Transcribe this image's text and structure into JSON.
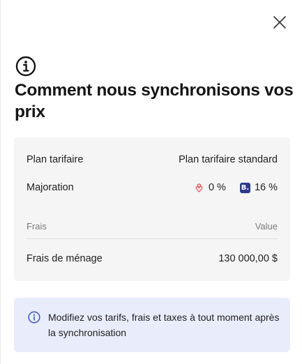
{
  "dialog": {
    "title": "Comment nous synchronisons vos prix",
    "close_icon": "close-icon",
    "header_icon": "info-circle-icon"
  },
  "summary": {
    "plan_label": "Plan tarifaire",
    "plan_value": "Plan tarifaire standard",
    "markup_label": "Majoration",
    "markup_airbnb": "0 %",
    "markup_booking": "16 %",
    "airbnb_icon": "airbnb-icon",
    "booking_icon": "booking-icon",
    "booking_badge": "B."
  },
  "fees": {
    "column_left": "Frais",
    "column_right": "Value",
    "rows": [
      {
        "label": "Frais de ménage",
        "value": "130 000,00 $"
      }
    ]
  },
  "notice": {
    "icon": "info-icon",
    "text": "Modifiez vos tarifs, frais et taxes à tout moment après la synchronisation"
  },
  "colors": {
    "airbnb": "#e8505b",
    "booking": "#2d3a8c",
    "notice_bg": "#e9ecfb",
    "notice_icon": "#3b55c4"
  }
}
